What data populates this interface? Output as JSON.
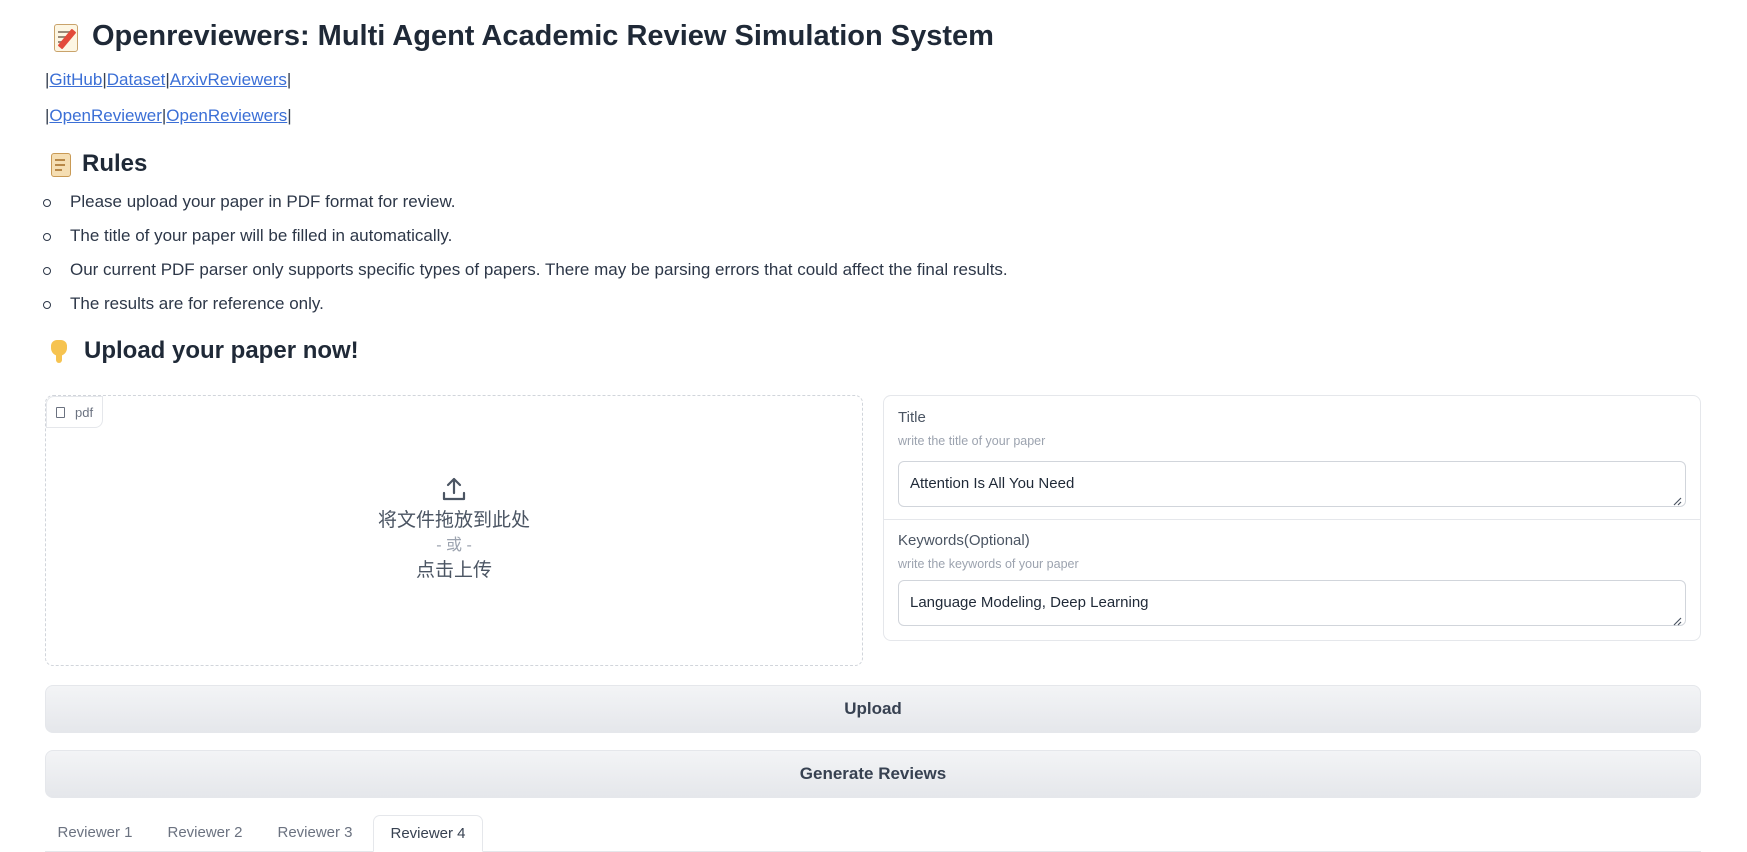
{
  "header": {
    "title": "Openreviewers: Multi Agent Academic Review Simulation System",
    "title_icon": "memo-icon"
  },
  "links_row1": {
    "sep": "|",
    "items": [
      "GitHub",
      "Dataset",
      "ArxivReviewers"
    ]
  },
  "links_row2": {
    "sep": "|",
    "items": [
      "OpenReviewer",
      "OpenReviewers"
    ]
  },
  "rules": {
    "heading": "Rules",
    "icon": "scroll-icon",
    "items": [
      "Please upload your paper in PDF format for review.",
      "The title of your paper will be filled in automatically.",
      "Our current PDF parser only supports specific types of papers. There may be parsing errors that could affect the final results.",
      "The results are for reference only."
    ]
  },
  "upload_section": {
    "heading": "Upload your paper now!",
    "icon": "pointing-down-hand-icon"
  },
  "file_upload": {
    "badge": "pdf",
    "drop_text": "将文件拖放到此处",
    "or_text": "- 或 -",
    "click_text": "点击上传"
  },
  "form": {
    "title_field": {
      "label": "Title",
      "info": "write the title of your paper",
      "value": "Attention Is All You Need"
    },
    "keywords_field": {
      "label": "Keywords(Optional)",
      "info": "write the keywords of your paper",
      "value": "Language Modeling, Deep Learning"
    }
  },
  "buttons": {
    "upload": "Upload",
    "generate": "Generate Reviews"
  },
  "tabs": {
    "items": [
      "Reviewer 1",
      "Reviewer 2",
      "Reviewer 3",
      "Reviewer 4"
    ],
    "active": "Reviewer 4"
  },
  "colors": {
    "link": "#3b6fd6",
    "text": "#1f2937",
    "border": "#e5e7eb"
  }
}
